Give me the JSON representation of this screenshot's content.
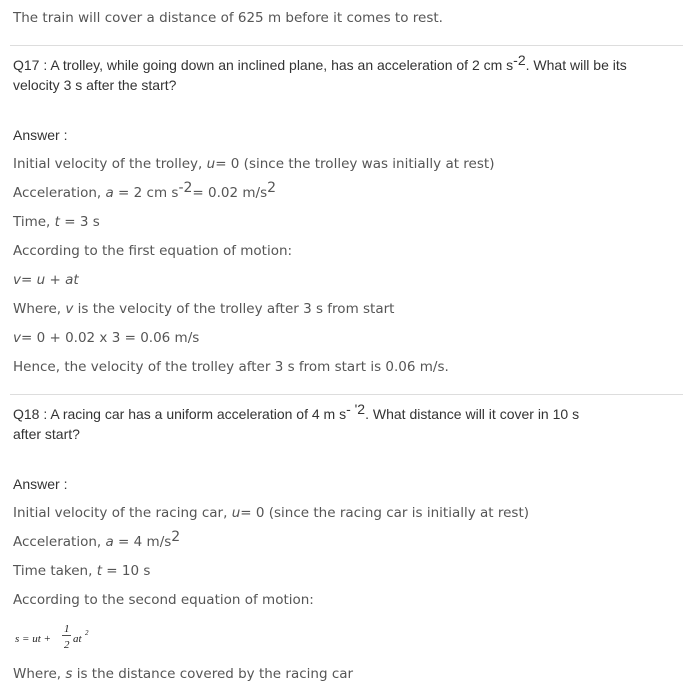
{
  "intro": {
    "text": "The train will cover a distance of 625 m before it comes to rest."
  },
  "q17": {
    "label": "Q17 :",
    "question_a": "A trolley, while going down an inclined plane, has an acceleration of 2 cm s",
    "question_sup": "-2",
    "question_b": ". What will be its",
    "question_line2": "velocity 3 s after the start?",
    "answer_label": "Answer :",
    "l1_a": "Initial velocity of the trolley, ",
    "l1_var": "u",
    "l1_b": "= 0 (since the trolley was initially at rest)",
    "l2_a": "Acceleration, ",
    "l2_var": "a",
    "l2_b": " = 2 cm s",
    "l2_sup1": "-2",
    "l2_c": "= 0.02 m/s",
    "l2_sup2": "2",
    "l3_a": "Time, ",
    "l3_var": "t",
    "l3_b": " = 3 s",
    "l4": "According to the first equation of motion:",
    "l5_v": "v",
    "l5_eq": "= ",
    "l5_u": "u",
    "l5_plus": " + ",
    "l5_at": "at",
    "l6_a": "Where, ",
    "l6_var": "v",
    "l6_b": " is the velocity of the trolley after 3 s from start",
    "l7_v": "v",
    "l7_b": "= 0 + 0.02 x 3 = 0.06 m/s",
    "l8": "Hence, the velocity of the trolley after 3 s from start is 0.06 m/s."
  },
  "q18": {
    "label": "Q18 :",
    "question_a": "A racing car has a uniform acceleration of 4 m s",
    "question_sup": "- '2",
    "question_b": ". What distance will it cover in 10 s",
    "question_line2": "after start?",
    "answer_label": "Answer :",
    "l1_a": "Initial velocity of the racing car, ",
    "l1_var": "u",
    "l1_b": "= 0 (since the racing car is initially at rest)",
    "l2_a": "Acceleration, ",
    "l2_var": "a",
    "l2_b": " = 4 m/s",
    "l2_sup": "2",
    "l3_a": "Time taken, ",
    "l3_var": "t",
    "l3_b": " = 10 s",
    "l4": "According to the second equation of motion:",
    "formula_left": "s = ut +",
    "formula_num": "1",
    "formula_den": "2",
    "formula_right": "at",
    "formula_sup": "2",
    "l5_a": "Where, ",
    "l5_var": "s",
    "l5_b": " is the distance covered by the racing car"
  }
}
